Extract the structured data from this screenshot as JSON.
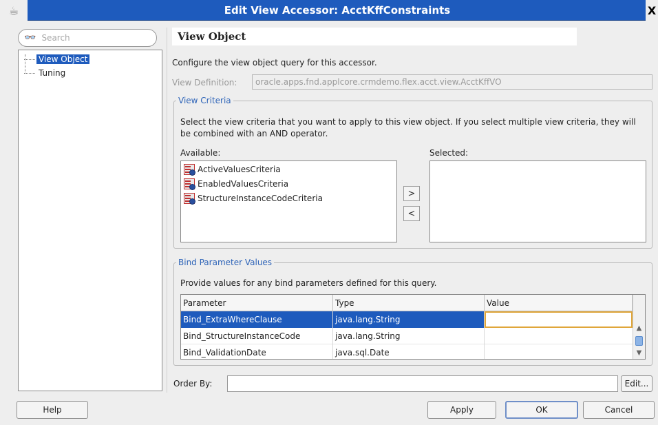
{
  "window": {
    "title": "Edit View Accessor: AcctKffConstraints",
    "close_glyph": "X"
  },
  "nav": {
    "search_placeholder": "Search",
    "items": [
      {
        "label": "View Object",
        "selected": true
      },
      {
        "label": "Tuning",
        "selected": false
      }
    ]
  },
  "panel": {
    "title": "View Object",
    "description": "Configure the view object query for this accessor.",
    "view_definition": {
      "label": "View Definition:",
      "value": "oracle.apps.fnd.applcore.crmdemo.flex.acct.view.AcctKffVO"
    }
  },
  "view_criteria": {
    "legend": "View Criteria",
    "description": "Select the view criteria that you want to apply to this view object. If you select multiple view criteria, they will be combined with an AND operator.",
    "available_label": "Available:",
    "selected_label": "Selected:",
    "available": [
      "ActiveValuesCriteria",
      "EnabledValuesCriteria",
      "StructureInstanceCodeCriteria"
    ],
    "selected": [],
    "move_right_glyph": ">",
    "move_left_glyph": "<"
  },
  "bind_params": {
    "legend": "Bind Parameter Values",
    "description": "Provide values for any bind parameters defined for this query.",
    "columns": [
      "Parameter",
      "Type",
      "Value"
    ],
    "rows": [
      {
        "parameter": "Bind_ExtraWhereClause",
        "type": "java.lang.String",
        "value": ""
      },
      {
        "parameter": "Bind_StructureInstanceCode",
        "type": "java.lang.String",
        "value": ""
      },
      {
        "parameter": "Bind_ValidationDate",
        "type": "java.sql.Date",
        "value": ""
      }
    ]
  },
  "order_by": {
    "label": "Order By:",
    "value": "",
    "edit_label": "Edit..."
  },
  "buttons": {
    "help": "Help",
    "apply": "Apply",
    "ok": "OK",
    "cancel": "Cancel"
  },
  "colors": {
    "titlebar": "#1e5bbd",
    "selection": "#1e5bbd",
    "legend_text": "#2e64b8",
    "focus_border": "#e0a63a"
  },
  "icons": {
    "app": "coffee-cup-icon",
    "search": "binoculars-icon",
    "criteria": "view-criteria-icon"
  }
}
